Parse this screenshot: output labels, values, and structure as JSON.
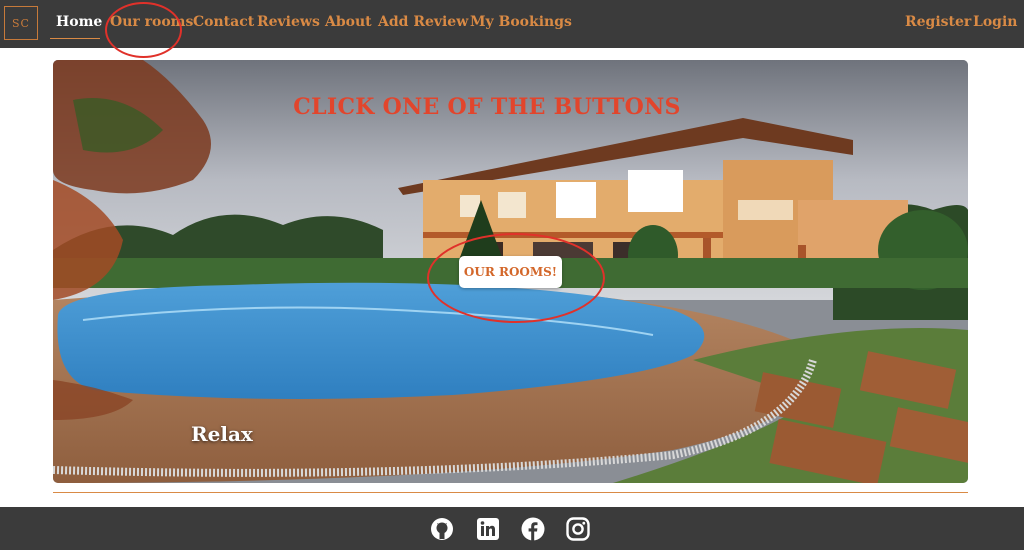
{
  "navbar": {
    "logo_text": "SC",
    "links": [
      "Home",
      "Our rooms",
      "Contact",
      "Reviews",
      "About",
      "Add Review",
      "My Bookings"
    ],
    "auth_links": [
      "Register",
      "Login"
    ]
  },
  "hero": {
    "title": "CLICK ONE OF THE BUTTONS",
    "button_label": "OUR ROOMS!",
    "caption": "Relax"
  },
  "footer": {
    "icons": [
      "github-icon",
      "linkedin-icon",
      "facebook-icon",
      "instagram-icon"
    ]
  },
  "colors": {
    "nav_bg": "#3b3b3b",
    "link": "#d98a45",
    "active_link": "#ffffff",
    "annotation": "#e0312a",
    "title": "#e2452c"
  }
}
